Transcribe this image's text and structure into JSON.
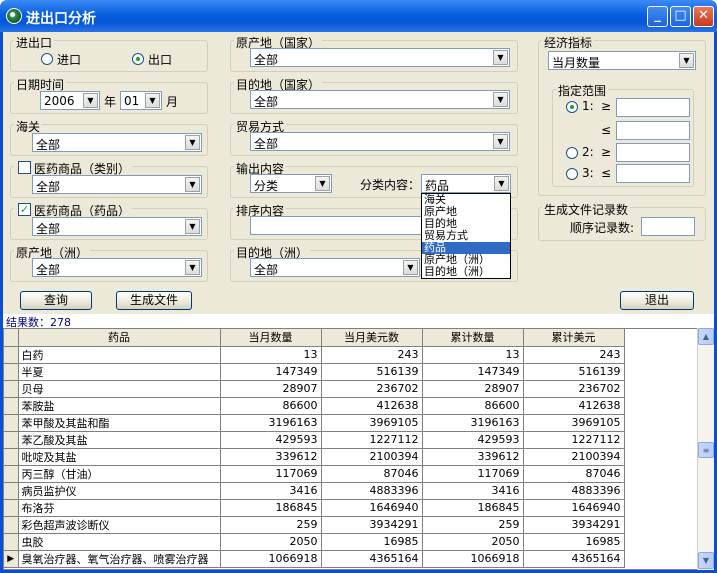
{
  "window": {
    "title": "进出口分析"
  },
  "import_export": {
    "label": "进出口",
    "import": "进口",
    "export": "出口",
    "selected": "出口"
  },
  "date": {
    "label": "日期时间",
    "year": "2006",
    "year_unit": "年",
    "month": "01",
    "month_unit": "月"
  },
  "customs": {
    "label": "海关",
    "value": "全部"
  },
  "med_category": {
    "label": "医药商品（类别）",
    "value": "全部",
    "checked": false
  },
  "med_drug": {
    "label": "医药商品（药品）",
    "value": "全部",
    "checked": true
  },
  "origin_continent": {
    "label": "原产地（洲）",
    "value": "全部"
  },
  "origin_country": {
    "label": "原产地（国家）",
    "value": "全部"
  },
  "dest_country": {
    "label": "目的地（国家）",
    "value": "全部"
  },
  "trade_mode": {
    "label": "贸易方式",
    "value": "全部"
  },
  "output": {
    "label": "输出内容",
    "value": "分类",
    "class_label": "分类内容：",
    "class_value": "药品",
    "options": [
      "海关",
      "原产地",
      "目的地",
      "贸易方式",
      "药品",
      "原产地（洲）",
      "目的地（洲）"
    ],
    "selected_option": "药品"
  },
  "sort": {
    "label": "排序内容"
  },
  "dest_continent": {
    "label": "目的地（洲）",
    "value": "全部"
  },
  "indicator": {
    "label": "经济指标",
    "value": "当月数量"
  },
  "range": {
    "label": "指定范围",
    "r1": "1:",
    "r2": "2:",
    "r3": "3:",
    "ge": "≥",
    "le": "≤",
    "ge2": "≥",
    "le2": "≤",
    "le3": "≤"
  },
  "genfile": {
    "label": "生成文件记录数",
    "seq_label": "顺序记录数:"
  },
  "buttons": {
    "query": "查询",
    "generate": "生成文件",
    "exit": "退出"
  },
  "result": {
    "count_text": "结果数：278"
  },
  "table": {
    "columns": [
      "药品",
      "当月数量",
      "当月美元数",
      "累计数量",
      "累计美元"
    ],
    "rows": [
      [
        "白药",
        "13",
        "243",
        "13",
        "243"
      ],
      [
        "半夏",
        "147349",
        "516139",
        "147349",
        "516139"
      ],
      [
        "贝母",
        "28907",
        "236702",
        "28907",
        "236702"
      ],
      [
        "苯胺盐",
        "86600",
        "412638",
        "86600",
        "412638"
      ],
      [
        "苯甲酸及其盐和酯",
        "3196163",
        "3969105",
        "3196163",
        "3969105"
      ],
      [
        "苯乙酸及其盐",
        "429593",
        "1227112",
        "429593",
        "1227112"
      ],
      [
        "吡啶及其盐",
        "339612",
        "2100394",
        "339612",
        "2100394"
      ],
      [
        "丙三醇（甘油）",
        "117069",
        "87046",
        "117069",
        "87046"
      ],
      [
        "病员监护仪",
        "3416",
        "4883396",
        "3416",
        "4883396"
      ],
      [
        "布洛芬",
        "186845",
        "1646940",
        "186845",
        "1646940"
      ],
      [
        "彩色超声波诊断仪",
        "259",
        "3934291",
        "259",
        "3934291"
      ],
      [
        "虫胶",
        "2050",
        "16985",
        "2050",
        "16985"
      ],
      [
        "臭氧治疗器、氧气治疗器、喷雾治疗器",
        "1066918",
        "4365164",
        "1066918",
        "4365164"
      ]
    ]
  }
}
